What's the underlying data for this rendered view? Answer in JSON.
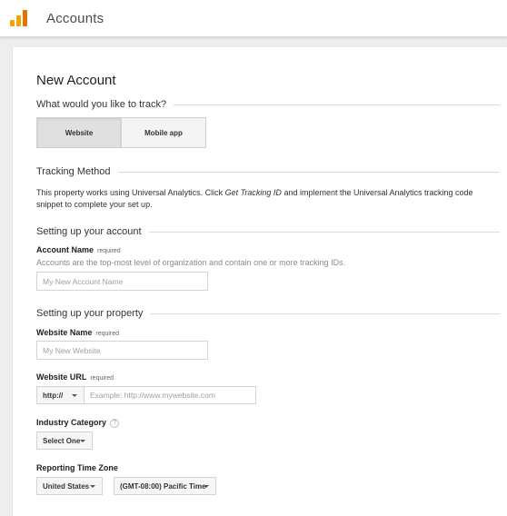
{
  "header": {
    "title": "Accounts",
    "logo_icon": "analytics-logo-icon",
    "brand_color": "#f4a300"
  },
  "page": {
    "title": "New Account"
  },
  "track": {
    "heading": "What would you like to track?",
    "options": [
      "Website",
      "Mobile app"
    ],
    "selected": "Website"
  },
  "tracking_method": {
    "heading": "Tracking Method",
    "text_before": "This property works using Universal Analytics. Click ",
    "text_link": "Get Tracking ID",
    "text_after": " and implement the Universal Analytics tracking code snippet to complete your set up."
  },
  "account": {
    "heading": "Setting up your account",
    "name_label": "Account Name",
    "required": "required",
    "help": "Accounts are the top-most level of organization and contain one or more tracking IDs.",
    "name_placeholder": "My New Account Name"
  },
  "property": {
    "heading": "Setting up your property",
    "website_name_label": "Website Name",
    "website_name_placeholder": "My New Website",
    "website_url_label": "Website URL",
    "protocol": "http://",
    "url_placeholder": "Example: http://www.mywebsite.com",
    "industry_label": "Industry Category",
    "industry_help_icon": "?",
    "industry_value": "Select One",
    "timezone_label": "Reporting Time Zone",
    "country_value": "United States",
    "timezone_value": "(GMT-08:00) Pacific Time",
    "required": "required"
  }
}
